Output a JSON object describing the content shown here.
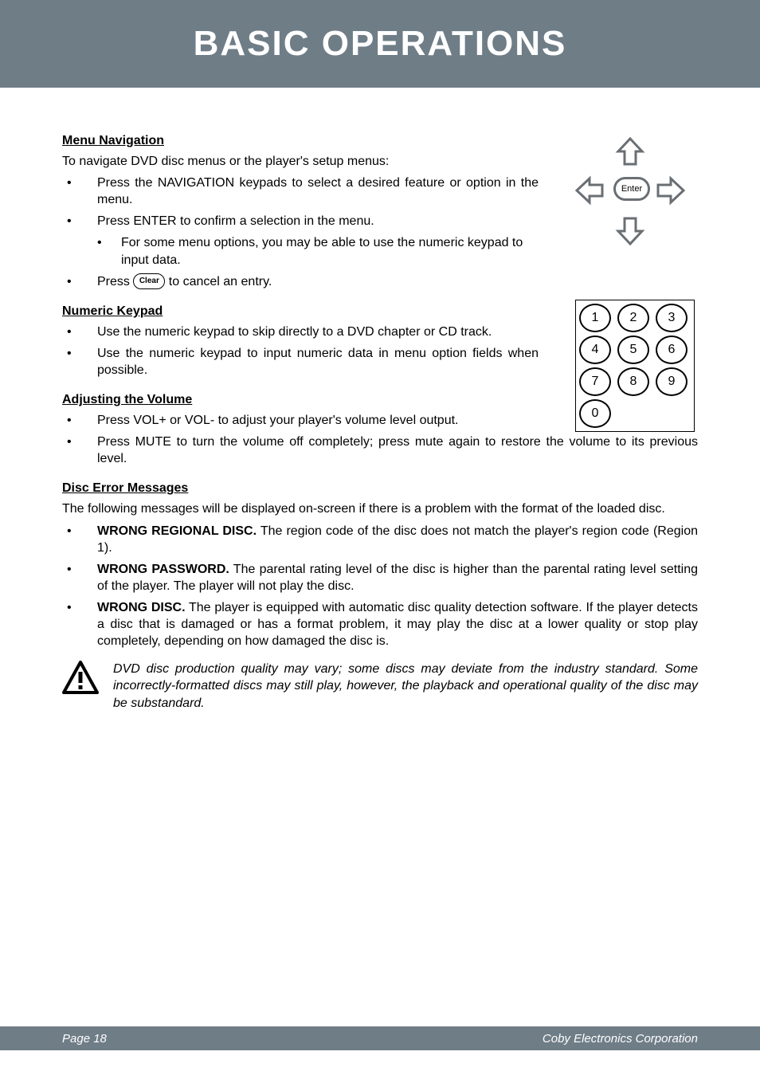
{
  "header": {
    "title": "BASIC OPERATIONS"
  },
  "sections": {
    "menu_nav": {
      "heading": "Menu Navigation",
      "intro": "To navigate DVD disc menus or the player's setup menus:",
      "b1": "Press the NAVIGATION keypads to select a desired feature or option in the menu.",
      "b2": "Press ENTER to confirm a selection in the menu.",
      "b2a": "For some menu options, you may be able to use the numeric keypad to input data.",
      "b3_prefix": "Press ",
      "b3_icon_label": "Clear",
      "b3_suffix": " to cancel an entry."
    },
    "numeric": {
      "heading": "Numeric Keypad",
      "b1": "Use the numeric keypad to skip directly to a DVD chapter or CD track.",
      "b2": "Use the numeric keypad to input numeric data in menu option fields when possible."
    },
    "volume": {
      "heading": "Adjusting the Volume",
      "b1": "Press VOL+ or VOL- to adjust your player's volume level output.",
      "b2": "Press MUTE to turn the volume off completely; press mute again to restore the volume to its previous level."
    },
    "errors": {
      "heading": "Disc Error Messages",
      "intro": "The following messages will be displayed on-screen if there is a problem with the format of the loaded disc.",
      "b1_strong": "WRONG REGIONAL DISC.",
      "b1_rest": " The region code of the disc does not match the player's region code (Region 1).",
      "b2_strong": "WRONG PASSWORD.",
      "b2_rest": " The parental rating level of the disc is higher than the parental rating level setting of the player. The player will not play the disc.",
      "b3_strong": "WRONG DISC.",
      "b3_rest": " The player is equipped with automatic disc quality detection software. If the player detects a disc that is damaged or has a format problem, it may play the disc at a lower quality or stop play completely, depending on how damaged the disc is."
    },
    "warning": {
      "text": "DVD disc production quality may vary; some discs may deviate from the industry standard. Some incorrectly-formatted discs may still play, however, the playback and operational quality of the disc may be substandard."
    }
  },
  "illustrations": {
    "dpad": {
      "enter_label": "Enter"
    },
    "keypad": {
      "r1": [
        "1",
        "2",
        "3"
      ],
      "r2": [
        "4",
        "5",
        "6"
      ],
      "r3": [
        "7",
        "8",
        "9"
      ],
      "r4": [
        "0"
      ]
    }
  },
  "footer": {
    "page": "Page 18",
    "company": "Coby Electronics Corporation"
  },
  "colors": {
    "band": "#6f7d87"
  }
}
